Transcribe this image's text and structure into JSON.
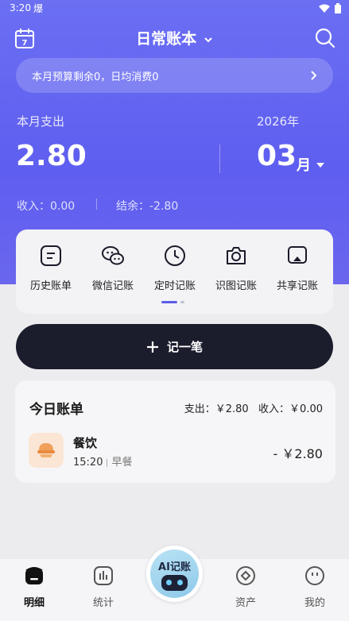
{
  "status_bar": {
    "time": "3:20",
    "app_glyph": "爆"
  },
  "header": {
    "title": "日常账本",
    "calendar_day": "7"
  },
  "budget_banner": {
    "text": "本月预算剩余0，日均消费0"
  },
  "summary": {
    "expense_label": "本月支出",
    "expense_value": "2.80",
    "year": "2026年",
    "month": "03",
    "month_unit": "月",
    "income": "收入：0.00",
    "balance": "结余：-2.80"
  },
  "quick_actions": [
    {
      "label": "历史账单",
      "icon": "history-bill-icon"
    },
    {
      "label": "微信记账",
      "icon": "wechat-icon"
    },
    {
      "label": "定时记账",
      "icon": "clock-icon"
    },
    {
      "label": "识图记账",
      "icon": "camera-icon"
    },
    {
      "label": "共享记账",
      "icon": "share-icon"
    }
  ],
  "add_button": {
    "label": "记一笔"
  },
  "today": {
    "title": "今日账单",
    "summary": "支出：￥2.80   收入：￥0.00",
    "entries": [
      {
        "category": "餐饮",
        "time": "15:20",
        "note": "早餐",
        "amount": "- ￥2.80"
      }
    ]
  },
  "tabbar": {
    "items": [
      {
        "label": "明细",
        "active": true
      },
      {
        "label": "统计",
        "active": false
      },
      {
        "label": "资产",
        "active": false
      },
      {
        "label": "我的",
        "active": false
      }
    ],
    "ai_label": "AI记账"
  },
  "colors": {
    "primary": "#5e5ef0",
    "dark_button": "#1b1c2c",
    "background": "#ececef"
  }
}
